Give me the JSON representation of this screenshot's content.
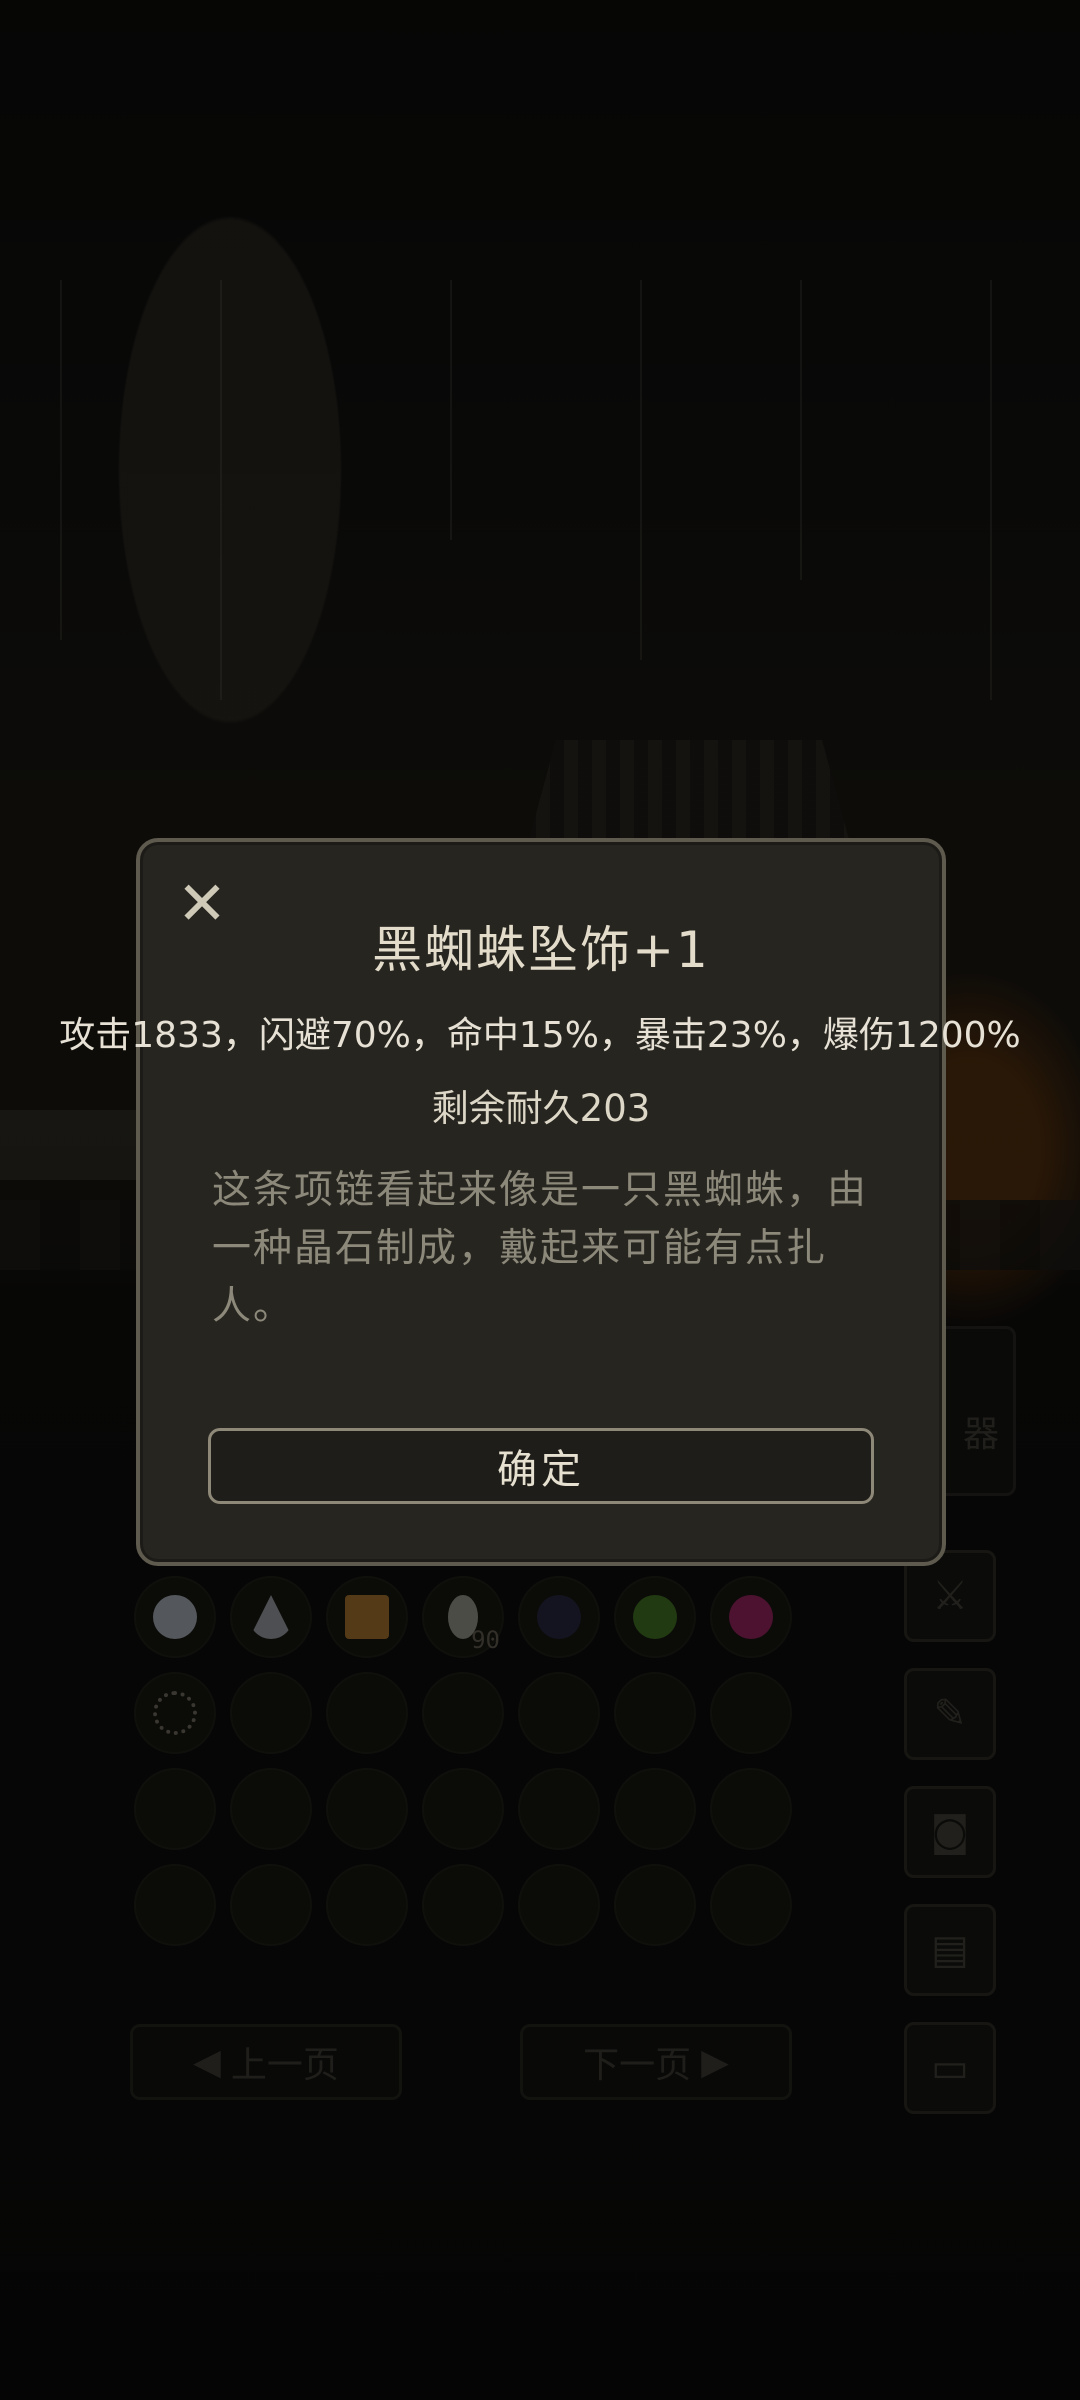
{
  "dialog": {
    "close_icon": "close-icon",
    "title": "黑蜘蛛坠饰+1",
    "stats": "攻击1833，闪避70%，命中15%，暴击23%，爆伤1200%",
    "durability": "剩余耐久203",
    "description": "这条项链看起来像是一只黑蜘蛛，由一种晶石制成，戴起来可能有点扎人。",
    "confirm_label": "确定"
  },
  "background": {
    "side_panel_label": "器",
    "prev_page_label": "上一页",
    "next_page_label": "下一页",
    "inventory_items": [
      {
        "name": "white-crystal-icon",
        "color": "#9aa0aa"
      },
      {
        "name": "pyramid-crystal-icon",
        "color": "#8e9096"
      },
      {
        "name": "book-icon",
        "color": "#9a6a2a"
      },
      {
        "name": "potion-icon",
        "color": "#8a8a80",
        "count": "90"
      },
      {
        "name": "dark-gem-icon",
        "color": "#23253a"
      },
      {
        "name": "green-gem-icon",
        "color": "#3c6a22"
      },
      {
        "name": "pink-gem-icon",
        "color": "#8a2258"
      },
      {
        "name": "necklace-icon",
        "color": "#6a655a"
      }
    ],
    "side_buttons": [
      "sword-icon",
      "note-icon",
      "camera-icon",
      "file-icon",
      "monitor-icon"
    ]
  },
  "colors": {
    "dialog_bg": "#262520",
    "dialog_border": "#5e5a4e",
    "title_text": "#e4dccb",
    "description_text": "#8c887a"
  }
}
